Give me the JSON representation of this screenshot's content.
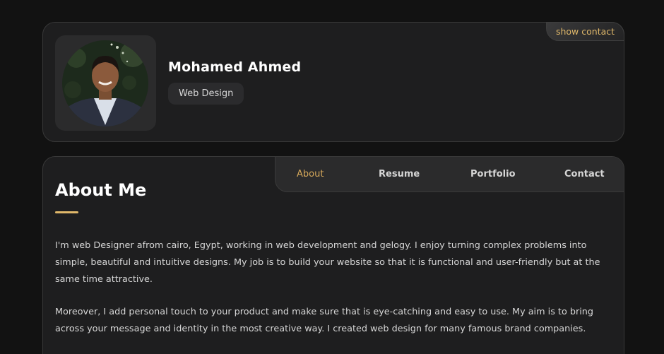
{
  "profile": {
    "name": "Mohamed Ahmed",
    "role": "Web Design",
    "show_contact_label": "show contact"
  },
  "nav": {
    "items": [
      {
        "label": "About",
        "active": true
      },
      {
        "label": "Resume",
        "active": false
      },
      {
        "label": "Portfolio",
        "active": false
      },
      {
        "label": "Contact",
        "active": false
      }
    ]
  },
  "about": {
    "title": "About Me",
    "paragraphs": [
      "I'm web Designer afrom cairo, Egypt, working in web development and gelogy. I enjoy turning complex problems into simple, beautiful and intuitive designs. My job is to build your website so that it is functional and user-friendly but at the same time attractive.",
      "Moreover, I add personal touch to your product and make sure that is eye-catching and easy to use. My aim is to bring across your message and identity in the most creative way. I created web design for many famous brand companies."
    ]
  },
  "colors": {
    "accent": "#e0b86a",
    "background": "#121212",
    "card": "#1e1e1f"
  }
}
